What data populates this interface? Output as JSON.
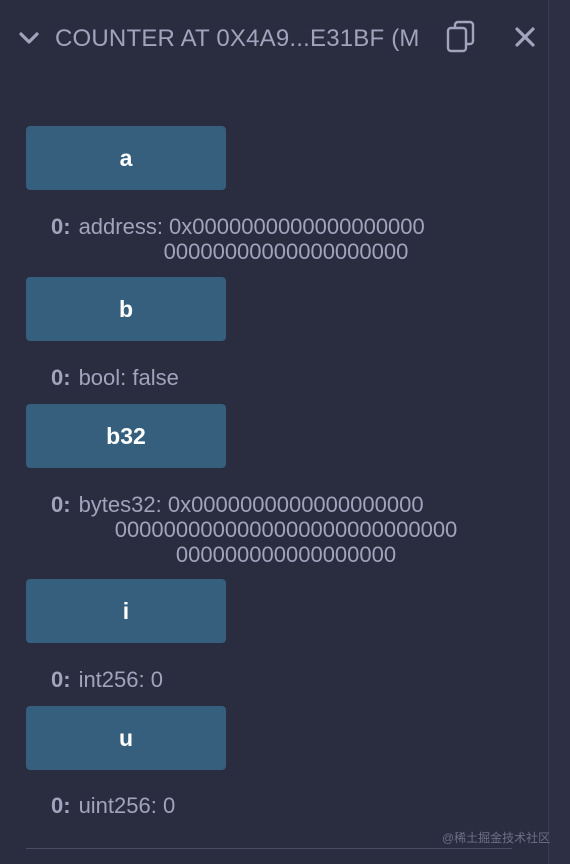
{
  "header": {
    "title": "COUNTER AT 0X4A9...E31BF (M",
    "chevron_icon": "chevron-down-icon",
    "copy_icon": "copy-icon",
    "close_icon": "close-icon"
  },
  "functions": [
    {
      "label": "a",
      "result_index": "0:",
      "result_lines": [
        "address: 0x0000000000000000000",
        "00000000000000000000"
      ]
    },
    {
      "label": "b",
      "result_index": "0:",
      "result_lines": [
        "bool: false"
      ]
    },
    {
      "label": "b32",
      "result_index": "0:",
      "result_lines": [
        "bytes32: 0x0000000000000000000",
        "0000000000000000000000000000",
        "000000000000000000"
      ]
    },
    {
      "label": "i",
      "result_index": "0:",
      "result_lines": [
        "int256: 0"
      ]
    },
    {
      "label": "u",
      "result_index": "0:",
      "result_lines": [
        "uint256: 0"
      ]
    }
  ],
  "watermark": "@稀土掘金技术社区",
  "colors": {
    "background": "#2a2c3f",
    "button": "#355f7d",
    "text": "#a2a3bd"
  }
}
